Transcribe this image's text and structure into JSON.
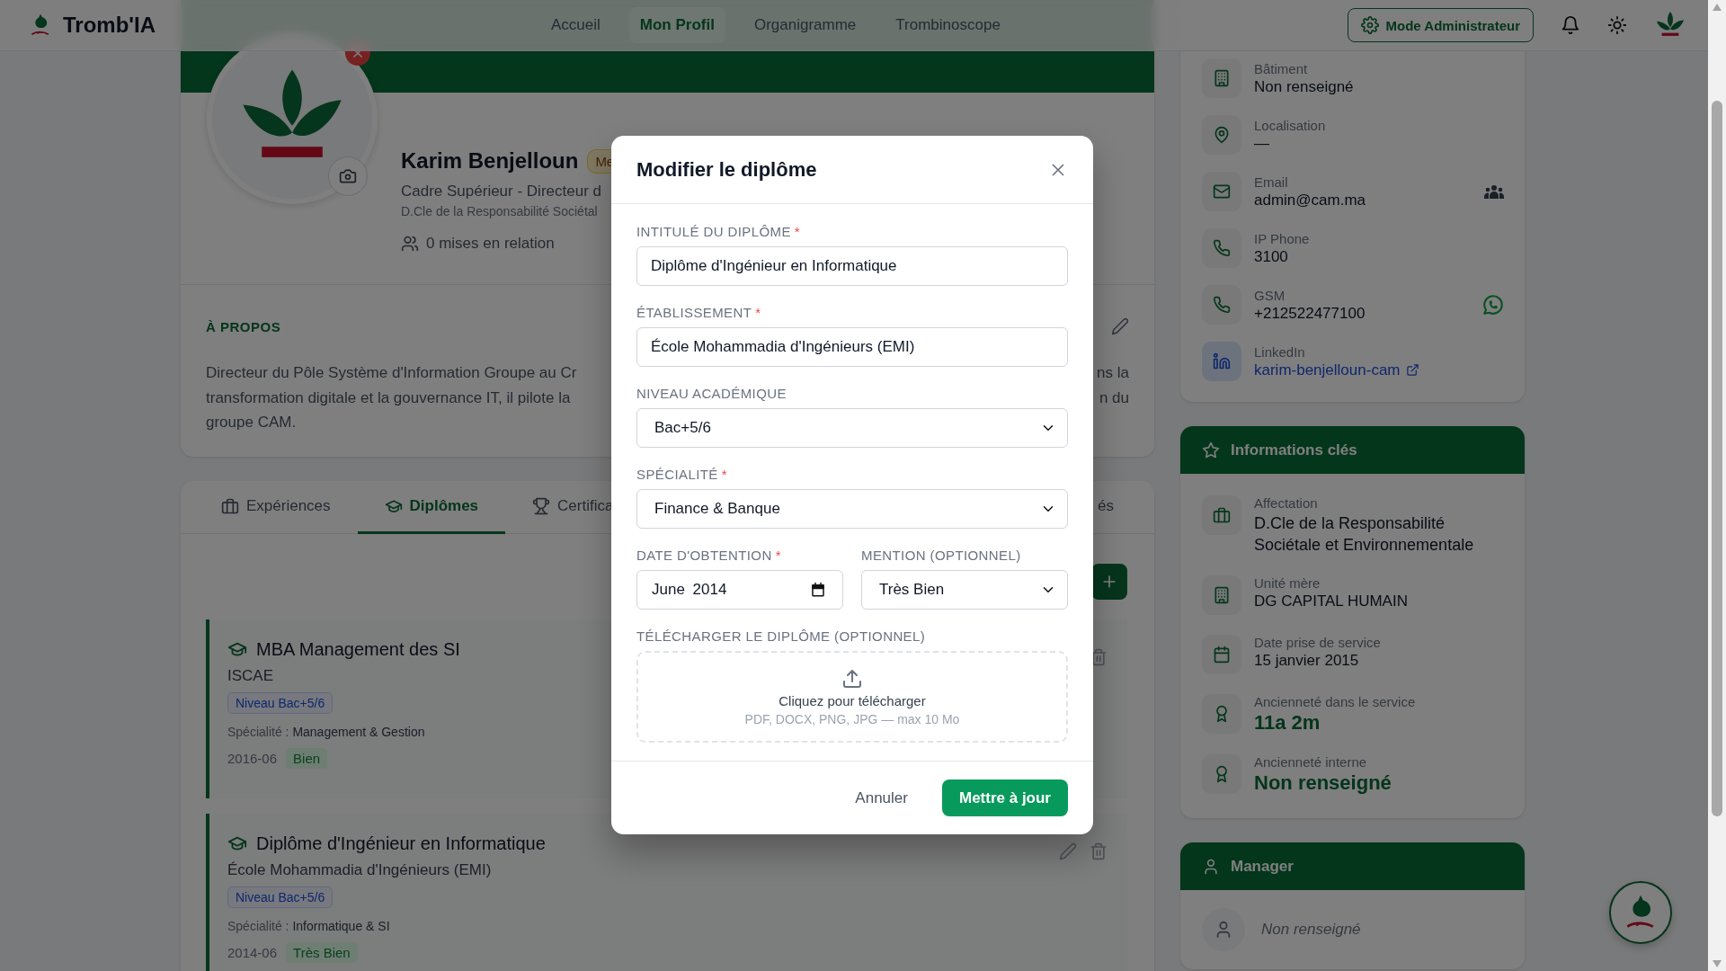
{
  "app": {
    "name": "Tromb'IA"
  },
  "nav": [
    {
      "label": "Accueil",
      "selected": false
    },
    {
      "label": "Mon Profil",
      "selected": true
    },
    {
      "label": "Organigramme",
      "selected": false
    },
    {
      "label": "Trombinoscope",
      "selected": false
    }
  ],
  "admin_button": "Mode Administrateur",
  "profile": {
    "name": "Karim Benjelloun",
    "badge": "Me",
    "title": "Cadre Supérieur - Directeur d",
    "unit": "D.Cle de la Responsabilité Sociétal",
    "connections": "0 mises en relation"
  },
  "about": {
    "heading": "À PROPOS",
    "lines_left": [
      "Directeur du Pôle Système d'Information Groupe au Cr",
      "transformation digitale et la gouvernance IT, il pilote la",
      "groupe CAM."
    ],
    "lines_right": [
      "ns la",
      "n du"
    ]
  },
  "tabs": [
    {
      "label": "Expériences",
      "kind": "experience",
      "selected": false
    },
    {
      "label": "Diplômes",
      "kind": "diploma",
      "selected": true
    },
    {
      "label": "Certifica",
      "kind": "certification",
      "selected": false
    },
    {
      "label": "és",
      "kind": "other",
      "selected": false
    }
  ],
  "diplomas": [
    {
      "title": "MBA Management des SI",
      "school": "ISCAE",
      "level": "Niveau Bac+5/6",
      "specialty": "Spécialité : **Management & Gestion**",
      "date": "2016-06",
      "mention": "Bien"
    },
    {
      "title": "Diplôme d'Ingénieur en Informatique",
      "school": "École Mohammadia d'Ingénieurs (EMI)",
      "level": "Niveau Bac+5/6",
      "specialty": "Spécialité : **Informatique & SI**",
      "date": "2014-06",
      "mention": "Très Bien"
    }
  ],
  "contact": [
    {
      "kind": "building",
      "label": "Bâtiment",
      "value": "Non renseigné"
    },
    {
      "kind": "location",
      "label": "Localisation",
      "value": "—"
    },
    {
      "kind": "email",
      "label": "Email",
      "value": "admin@cam.ma"
    },
    {
      "kind": "phone",
      "label": "IP Phone",
      "value": "3100"
    },
    {
      "kind": "mobile",
      "label": "GSM",
      "value": "+212522477100"
    },
    {
      "kind": "linkedin",
      "label": "LinkedIn",
      "value": "karim-benjelloun-cam"
    }
  ],
  "key_info": {
    "title": "Informations clés",
    "items": [
      {
        "kind": "assignment",
        "label": "Affectation",
        "value": "D.Cle de la Responsabilité Sociétale et Environnementale",
        "emphasis": false
      },
      {
        "kind": "building",
        "label": "Unité mère",
        "value": "DG CAPITAL HUMAIN",
        "emphasis": false
      },
      {
        "kind": "date",
        "label": "Date prise de service",
        "value": "15 janvier 2015",
        "emphasis": false
      },
      {
        "kind": "seniority",
        "label": "Ancienneté dans le service",
        "value": "11a 2m",
        "emphasis": true
      },
      {
        "kind": "seniority",
        "label": "Ancienneté interne",
        "value": "Non renseigné",
        "emphasis": true
      }
    ]
  },
  "manager": {
    "title": "Manager",
    "value": "Non renseigné"
  },
  "modal": {
    "title": "Modifier le diplôme",
    "required_mark": "*",
    "rows": [
      [
        {
          "kind": "text",
          "label": "INTITULÉ DU DIPLÔME",
          "required": true,
          "value": "Diplôme d'Ingénieur en Informatique"
        }
      ],
      [
        {
          "kind": "text",
          "label": "ÉTABLISSEMENT",
          "required": true,
          "value": "École Mohammadia d'Ingénieurs (EMI)"
        }
      ],
      [
        {
          "kind": "select",
          "label": "NIVEAU ACADÉMIQUE",
          "required": false,
          "value": "Bac+5/6"
        }
      ],
      [
        {
          "kind": "select",
          "label": "SPÉCIALITÉ",
          "required": true,
          "value": "Finance & Banque"
        }
      ],
      [
        {
          "kind": "date",
          "label": "DATE D'OBTENTION",
          "required": true,
          "value": "June 2014"
        },
        {
          "kind": "select",
          "label": "MENTION (OPTIONNEL)",
          "required": false,
          "value": "Très Bien"
        }
      ]
    ],
    "upload": {
      "label": "TÉLÉCHARGER LE DIPLÔME (OPTIONNEL)",
      "text": "Cliquez pour télécharger",
      "hint": "PDF, DOCX, PNG, JPG — max 10 Mo"
    },
    "cancel": "Annuler",
    "submit": "Mettre à jour"
  }
}
